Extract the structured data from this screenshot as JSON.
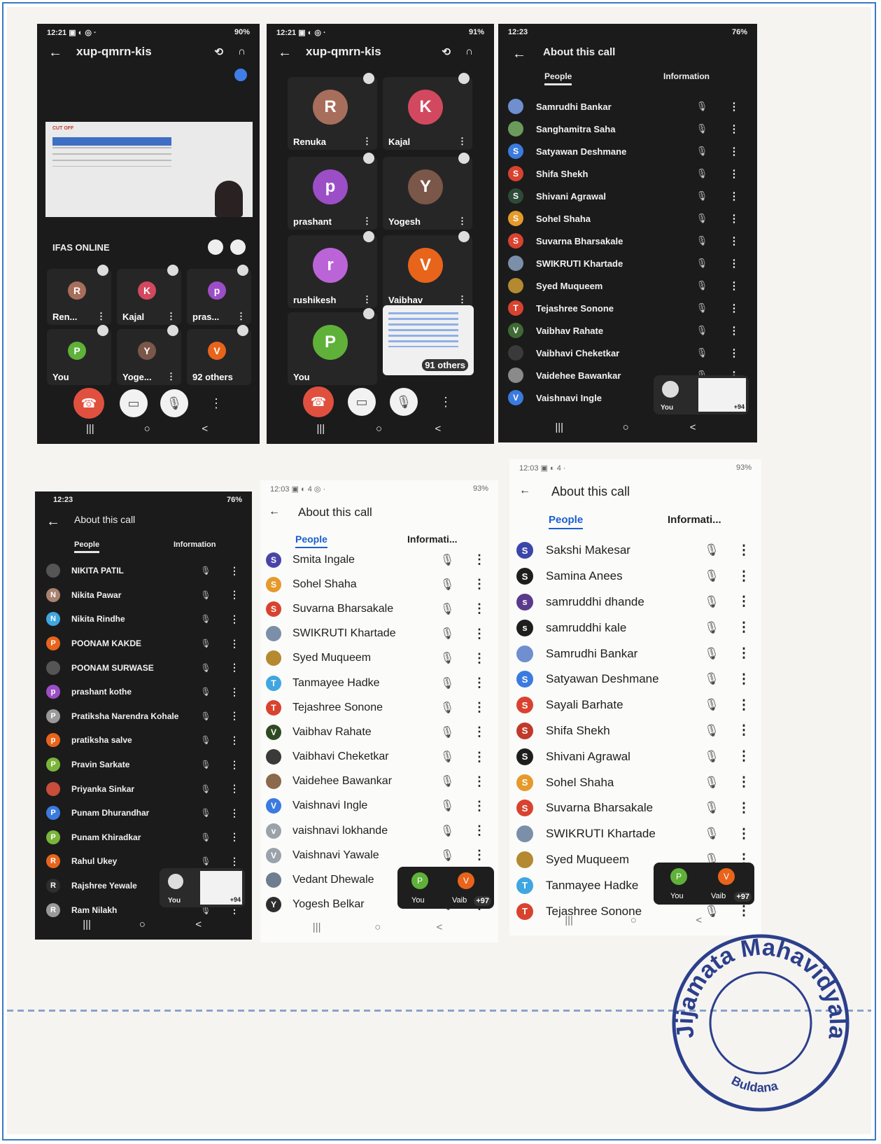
{
  "phone1": {
    "time": "12:21 ▣ ◐ ◎ ·",
    "status_right": "90%",
    "meeting_code": "xup-qmrn-kis",
    "presenter_label": "IFAS ONLINE",
    "slide_title": "CUT OFF",
    "tiles": [
      {
        "initial": "R",
        "label": "Ren...",
        "color": "#a86e5c"
      },
      {
        "initial": "K",
        "label": "Kajal",
        "color": "#d2495f"
      },
      {
        "initial": "p",
        "label": "pras...",
        "color": "#9c4ec7"
      },
      {
        "initial": "P",
        "label": "You",
        "color": "#5fb139"
      },
      {
        "initial": "Y",
        "label": "Yoge...",
        "color": "#7b5749"
      },
      {
        "initial": "V",
        "label": "92 others",
        "color": "#e8641b"
      }
    ]
  },
  "phone2": {
    "time": "12:21 ▣ ◐ ◎ ·",
    "status_right": "91%",
    "meeting_code": "xup-qmrn-kis",
    "tiles": [
      {
        "initial": "R",
        "label": "Renuka",
        "color": "#a86e5c"
      },
      {
        "initial": "K",
        "label": "Kajal",
        "color": "#d2495f"
      },
      {
        "initial": "p",
        "label": "prashant",
        "color": "#9c4ec7"
      },
      {
        "initial": "Y",
        "label": "Yogesh",
        "color": "#7b5749"
      },
      {
        "initial": "r",
        "label": "rushikesh",
        "color": "#bb64d8"
      },
      {
        "initial": "V",
        "label": "Vaibhav",
        "color": "#e8641b"
      },
      {
        "initial": "P",
        "label": "You",
        "color": "#5fb139"
      }
    ],
    "others_label": "91 others"
  },
  "phone3": {
    "time": "12:23",
    "status_right": "76%",
    "title": "About this call",
    "tab_people": "People",
    "tab_info": "Information",
    "people": [
      {
        "name": "Samrudhi Bankar",
        "initial": "",
        "color": "#6f8fcf"
      },
      {
        "name": "Sanghamitra Saha",
        "initial": "",
        "color": "#6a9b5a"
      },
      {
        "name": "Satyawan Deshmane",
        "initial": "S",
        "color": "#3b7be0"
      },
      {
        "name": "Shifa Shekh",
        "initial": "S",
        "color": "#d8432f"
      },
      {
        "name": "Shivani Agrawal",
        "initial": "S",
        "color": "#2e4a38"
      },
      {
        "name": "Sohel Shaha",
        "initial": "S",
        "color": "#e59a2b"
      },
      {
        "name": "Suvarna Bharsakale",
        "initial": "S",
        "color": "#d8432f"
      },
      {
        "name": "SWIKRUTI Khartade",
        "initial": "",
        "color": "#7b8fa8"
      },
      {
        "name": "Syed Muqueem",
        "initial": "",
        "color": "#b5892f"
      },
      {
        "name": "Tejashree Sonone",
        "initial": "T",
        "color": "#d8432f"
      },
      {
        "name": "Vaibhav Rahate",
        "initial": "V",
        "color": "#3e6b34"
      },
      {
        "name": "Vaibhavi Cheketkar",
        "initial": "",
        "color": "#3a3a3a"
      },
      {
        "name": "Vaidehee Bawankar",
        "initial": "",
        "color": "#8a8a8a"
      },
      {
        "name": "Vaishnavi Ingle",
        "initial": "V",
        "color": "#3b7be0"
      }
    ],
    "mini_you": "You",
    "mini_count": "+94"
  },
  "phone4": {
    "time": "12:23",
    "status_right": "76%",
    "title": "About this call",
    "tab_people": "People",
    "tab_info": "Information",
    "people": [
      {
        "name": "NIKITA PATIL",
        "initial": "",
        "color": "#555"
      },
      {
        "name": "Nikita Pawar",
        "initial": "N",
        "color": "#a98270"
      },
      {
        "name": "Nikita Rindhe",
        "initial": "N",
        "color": "#3fa6e0"
      },
      {
        "name": "POONAM KAKDE",
        "initial": "P",
        "color": "#e8641b"
      },
      {
        "name": "POONAM SURWASE",
        "initial": "",
        "color": "#555"
      },
      {
        "name": "prashant kothe",
        "initial": "p",
        "color": "#9c4ec7"
      },
      {
        "name": "Pratiksha Narendra Kohale",
        "initial": "P",
        "color": "#9a9a9a"
      },
      {
        "name": "pratiksha salve",
        "initial": "p",
        "color": "#e8641b"
      },
      {
        "name": "Pravin Sarkate",
        "initial": "P",
        "color": "#7bb43a"
      },
      {
        "name": "Priyanka Sinkar",
        "initial": "",
        "color": "#c84d3a"
      },
      {
        "name": "Punam Dhurandhar",
        "initial": "P",
        "color": "#3b7be0"
      },
      {
        "name": "Punam Khiradkar",
        "initial": "P",
        "color": "#7bb43a"
      },
      {
        "name": "Rahul Ukey",
        "initial": "R",
        "color": "#e8641b"
      },
      {
        "name": "Rajshree Yewale",
        "initial": "R",
        "color": "#2e2e2e"
      },
      {
        "name": "Ram Nilakh",
        "initial": "R",
        "color": "#9a9a9a"
      }
    ],
    "mini_you": "You",
    "mini_count": "+94"
  },
  "phone5": {
    "time": "12:03 ▣ ◐ 4 ◎ ·",
    "status_right": "93%",
    "title": "About this call",
    "tab_people": "People",
    "tab_info": "Informati...",
    "people": [
      {
        "name": "Smita Ingale",
        "initial": "S",
        "color": "#4b44a8"
      },
      {
        "name": "Sohel Shaha",
        "initial": "S",
        "color": "#e59a2b"
      },
      {
        "name": "Suvarna Bharsakale",
        "initial": "S",
        "color": "#d8432f"
      },
      {
        "name": "SWIKRUTI Khartade",
        "initial": "",
        "color": "#7b8fa8"
      },
      {
        "name": "Syed Muqueem",
        "initial": "",
        "color": "#b5892f"
      },
      {
        "name": "Tanmayee Hadke",
        "initial": "T",
        "color": "#3fa6e0"
      },
      {
        "name": "Tejashree Sonone",
        "initial": "T",
        "color": "#d8432f"
      },
      {
        "name": "Vaibhav Rahate",
        "initial": "V",
        "color": "#2e4a22"
      },
      {
        "name": "Vaibhavi Cheketkar",
        "initial": "",
        "color": "#3a3a3a"
      },
      {
        "name": "Vaidehee Bawankar",
        "initial": "",
        "color": "#8a6a4a"
      },
      {
        "name": "Vaishnavi Ingle",
        "initial": "V",
        "color": "#3b7be0"
      },
      {
        "name": "vaishnavi lokhande",
        "initial": "v",
        "color": "#9aa2aa"
      },
      {
        "name": "Vaishnavi Yawale",
        "initial": "V",
        "color": "#9aa2aa"
      },
      {
        "name": "Vedant Dhewale",
        "initial": "",
        "color": "#6f7e8f"
      },
      {
        "name": "Yogesh Belkar",
        "initial": "Y",
        "color": "#2e2e2e"
      }
    ],
    "pip_you": "You",
    "pip_other": "Vaib",
    "pip_count": "+97"
  },
  "phone6": {
    "time": "12:03 ▣ ◐ 4 ·",
    "status_right": "93%",
    "title": "About this call",
    "tab_people": "People",
    "tab_info": "Informati...",
    "people": [
      {
        "name": "Sakshi Makesar",
        "initial": "S",
        "color": "#3b47a8"
      },
      {
        "name": "Samina Anees",
        "initial": "S",
        "color": "#1e1e1e"
      },
      {
        "name": "samruddhi dhande",
        "initial": "s",
        "color": "#5a3a8a"
      },
      {
        "name": "samruddhi kale",
        "initial": "s",
        "color": "#1e1e1e"
      },
      {
        "name": "Samrudhi Bankar",
        "initial": "",
        "color": "#6f8fcf"
      },
      {
        "name": "Satyawan Deshmane",
        "initial": "S",
        "color": "#3b7be0"
      },
      {
        "name": "Sayali Barhate",
        "initial": "S",
        "color": "#d8432f"
      },
      {
        "name": "Shifa Shekh",
        "initial": "S",
        "color": "#c0392b"
      },
      {
        "name": "Shivani Agrawal",
        "initial": "S",
        "color": "#1e1e1e"
      },
      {
        "name": "Sohel Shaha",
        "initial": "S",
        "color": "#e59a2b"
      },
      {
        "name": "Suvarna Bharsakale",
        "initial": "S",
        "color": "#d8432f"
      },
      {
        "name": "SWIKRUTI Khartade",
        "initial": "",
        "color": "#7b8fa8"
      },
      {
        "name": "Syed Muqueem",
        "initial": "",
        "color": "#b5892f"
      },
      {
        "name": "Tanmayee Hadke",
        "initial": "T",
        "color": "#3fa6e0"
      },
      {
        "name": "Tejashree Sonone",
        "initial": "T",
        "color": "#d8432f"
      }
    ],
    "pip_you": "You",
    "pip_other": "Vaib",
    "pip_count": "+97"
  },
  "stamp": {
    "top": "Jijamata Mahavidyalaya",
    "bottom": "Buldana"
  },
  "icons": {
    "back": "←",
    "mic_off": "🎙",
    "more": "⋮",
    "nav_recent": "|||",
    "nav_home": "○",
    "nav_back": "<"
  }
}
